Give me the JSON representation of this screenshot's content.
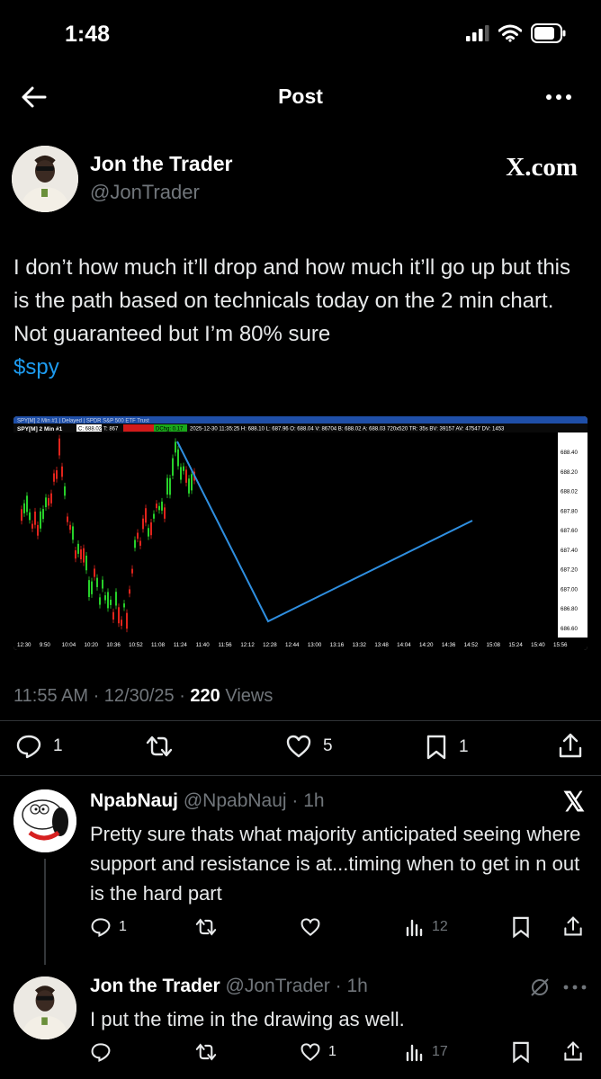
{
  "status": {
    "time": "1:48"
  },
  "header": {
    "title": "Post"
  },
  "post": {
    "author_name": "Jon the Trader",
    "author_handle": "@JonTrader",
    "source_label": "X.com",
    "text": "I don’t how much it’ll drop and how much it’ll go up but this is the path based on technicals today on the 2 min chart. Not guaranteed but I’m 80% sure",
    "cashtag": "$spy",
    "timestamp": "11:55 AM · 12/30/25 · ",
    "views_count": "220",
    "views_label": " Views",
    "replies": "1",
    "likes": "5",
    "bookmarks": "1"
  },
  "chart_image": {
    "window_title": "SPY[M] 2 Min #1 | Delayed | SPDR S&P 500 ETF Trust",
    "header_symbol": "SPY[M] 2 Min #1",
    "header_c": "C: 688.02",
    "header_t": "T: 867",
    "header_dchg": "DChg: 0.17",
    "header_info": "2025-12-30 11:35:25 H: 688.10 L: 687.96 O: 688.04 V: 86704 B: 688.02 A: 688.03 720x520 TR: 35s BV: 39157 AV: 47547 DV: 1453",
    "y_ticks": [
      "688.40",
      "688.20",
      "688.02",
      "687.80",
      "687.60",
      "687.40",
      "687.20",
      "687.00",
      "686.80",
      "686.60"
    ],
    "x_ticks": [
      "12:30",
      "9:50",
      "10:04",
      "10:20",
      "10:36",
      "10:52",
      "11:08",
      "11:24",
      "11:40",
      "11:56",
      "12:12",
      "12:28",
      "12:44",
      "13:00",
      "13:16",
      "13:32",
      "13:48",
      "14:04",
      "14:20",
      "14:36",
      "14:52",
      "15:08",
      "15:24",
      "15:40",
      "15:56"
    ]
  },
  "replies": [
    {
      "name": "NpabNauj",
      "handle": "@NpabNauj · 1h",
      "text": "Pretty sure thats what majority anticipated seeing where support and resistance is at...timing when to get in n out is the hard part",
      "replies": "1",
      "reposts": "",
      "likes": "",
      "views": "12"
    },
    {
      "name": "Jon the Trader",
      "handle": "@JonTrader · 1h",
      "text": "I put the time in the drawing as well.",
      "replies": "",
      "reposts": "",
      "likes": "1",
      "views": "17"
    }
  ],
  "colors": {
    "link": "#1d9bf0",
    "muted": "#71767b",
    "text": "#e7e9ea",
    "background": "#000000",
    "drawn_line": "#2f8fe0"
  }
}
